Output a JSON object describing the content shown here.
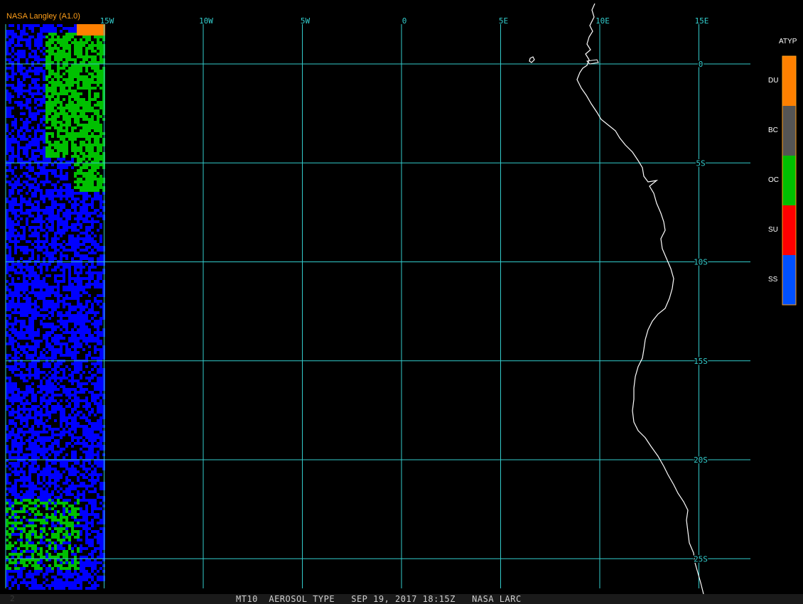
{
  "credit": "NASA Langley (A1.0)",
  "caption": "MT10  AEROSOL TYPE   SEP 19, 2017 18:15Z   NASA LARC",
  "frame_number": "2",
  "longitude_labels": [
    {
      "text": "15W",
      "lon": -15
    },
    {
      "text": "10W",
      "lon": -10
    },
    {
      "text": "5W",
      "lon": -5
    },
    {
      "text": "0",
      "lon": 0
    },
    {
      "text": "5E",
      "lon": 5
    },
    {
      "text": "10E",
      "lon": 10
    },
    {
      "text": "15E",
      "lon": 15
    }
  ],
  "latitude_labels": [
    {
      "text": "0",
      "lat": 0
    },
    {
      "text": "5S",
      "lat": -5
    },
    {
      "text": "10S",
      "lat": -10
    },
    {
      "text": "15S",
      "lat": -15
    },
    {
      "text": "20S",
      "lat": -20
    },
    {
      "text": "25S",
      "lat": -25
    }
  ],
  "legend": {
    "title": "ATYP",
    "items": [
      {
        "label": "DU",
        "color": "#ff8000"
      },
      {
        "label": "BC",
        "color": "#555555"
      },
      {
        "label": "OC",
        "color": "#00c000"
      },
      {
        "label": "SU",
        "color": "#ff0000"
      },
      {
        "label": "SS",
        "color": "#0050ff"
      }
    ]
  },
  "colors": {
    "grid": "#33cccc",
    "coast": "#ffffff",
    "sea_salt_pixel": "#0000ff",
    "organic_carbon_pixel": "#00c000",
    "dust_pixel": "#ff8000"
  }
}
